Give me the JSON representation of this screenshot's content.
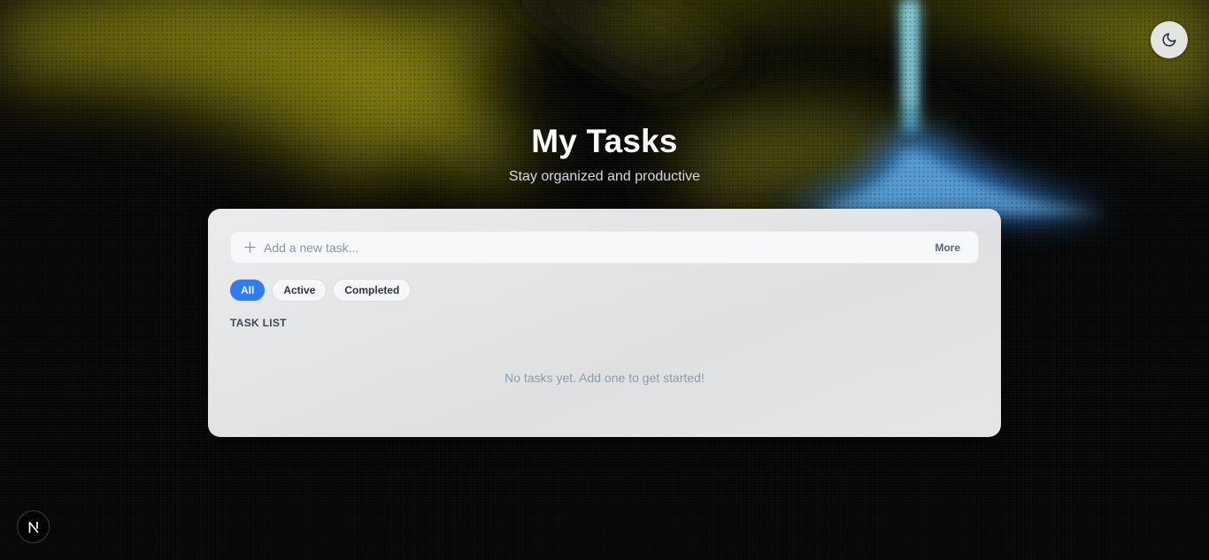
{
  "header": {
    "title": "My Tasks",
    "subtitle": "Stay organized and productive"
  },
  "theme_toggle": {
    "icon": "moon-icon"
  },
  "add_task": {
    "placeholder": "Add a new task...",
    "more_label": "More",
    "icon": "plus-icon"
  },
  "filters": [
    {
      "label": "All",
      "active": true
    },
    {
      "label": "Active",
      "active": false
    },
    {
      "label": "Completed",
      "active": false
    }
  ],
  "task_list": {
    "heading": "TASK LIST",
    "empty_message": "No tasks yet. Add one to get started!"
  },
  "badge": {
    "label": "N",
    "icon": "nextjs-logo-icon"
  },
  "colors": {
    "accent": "#2f7cf6",
    "background": "#060606",
    "card": "#ececed"
  }
}
